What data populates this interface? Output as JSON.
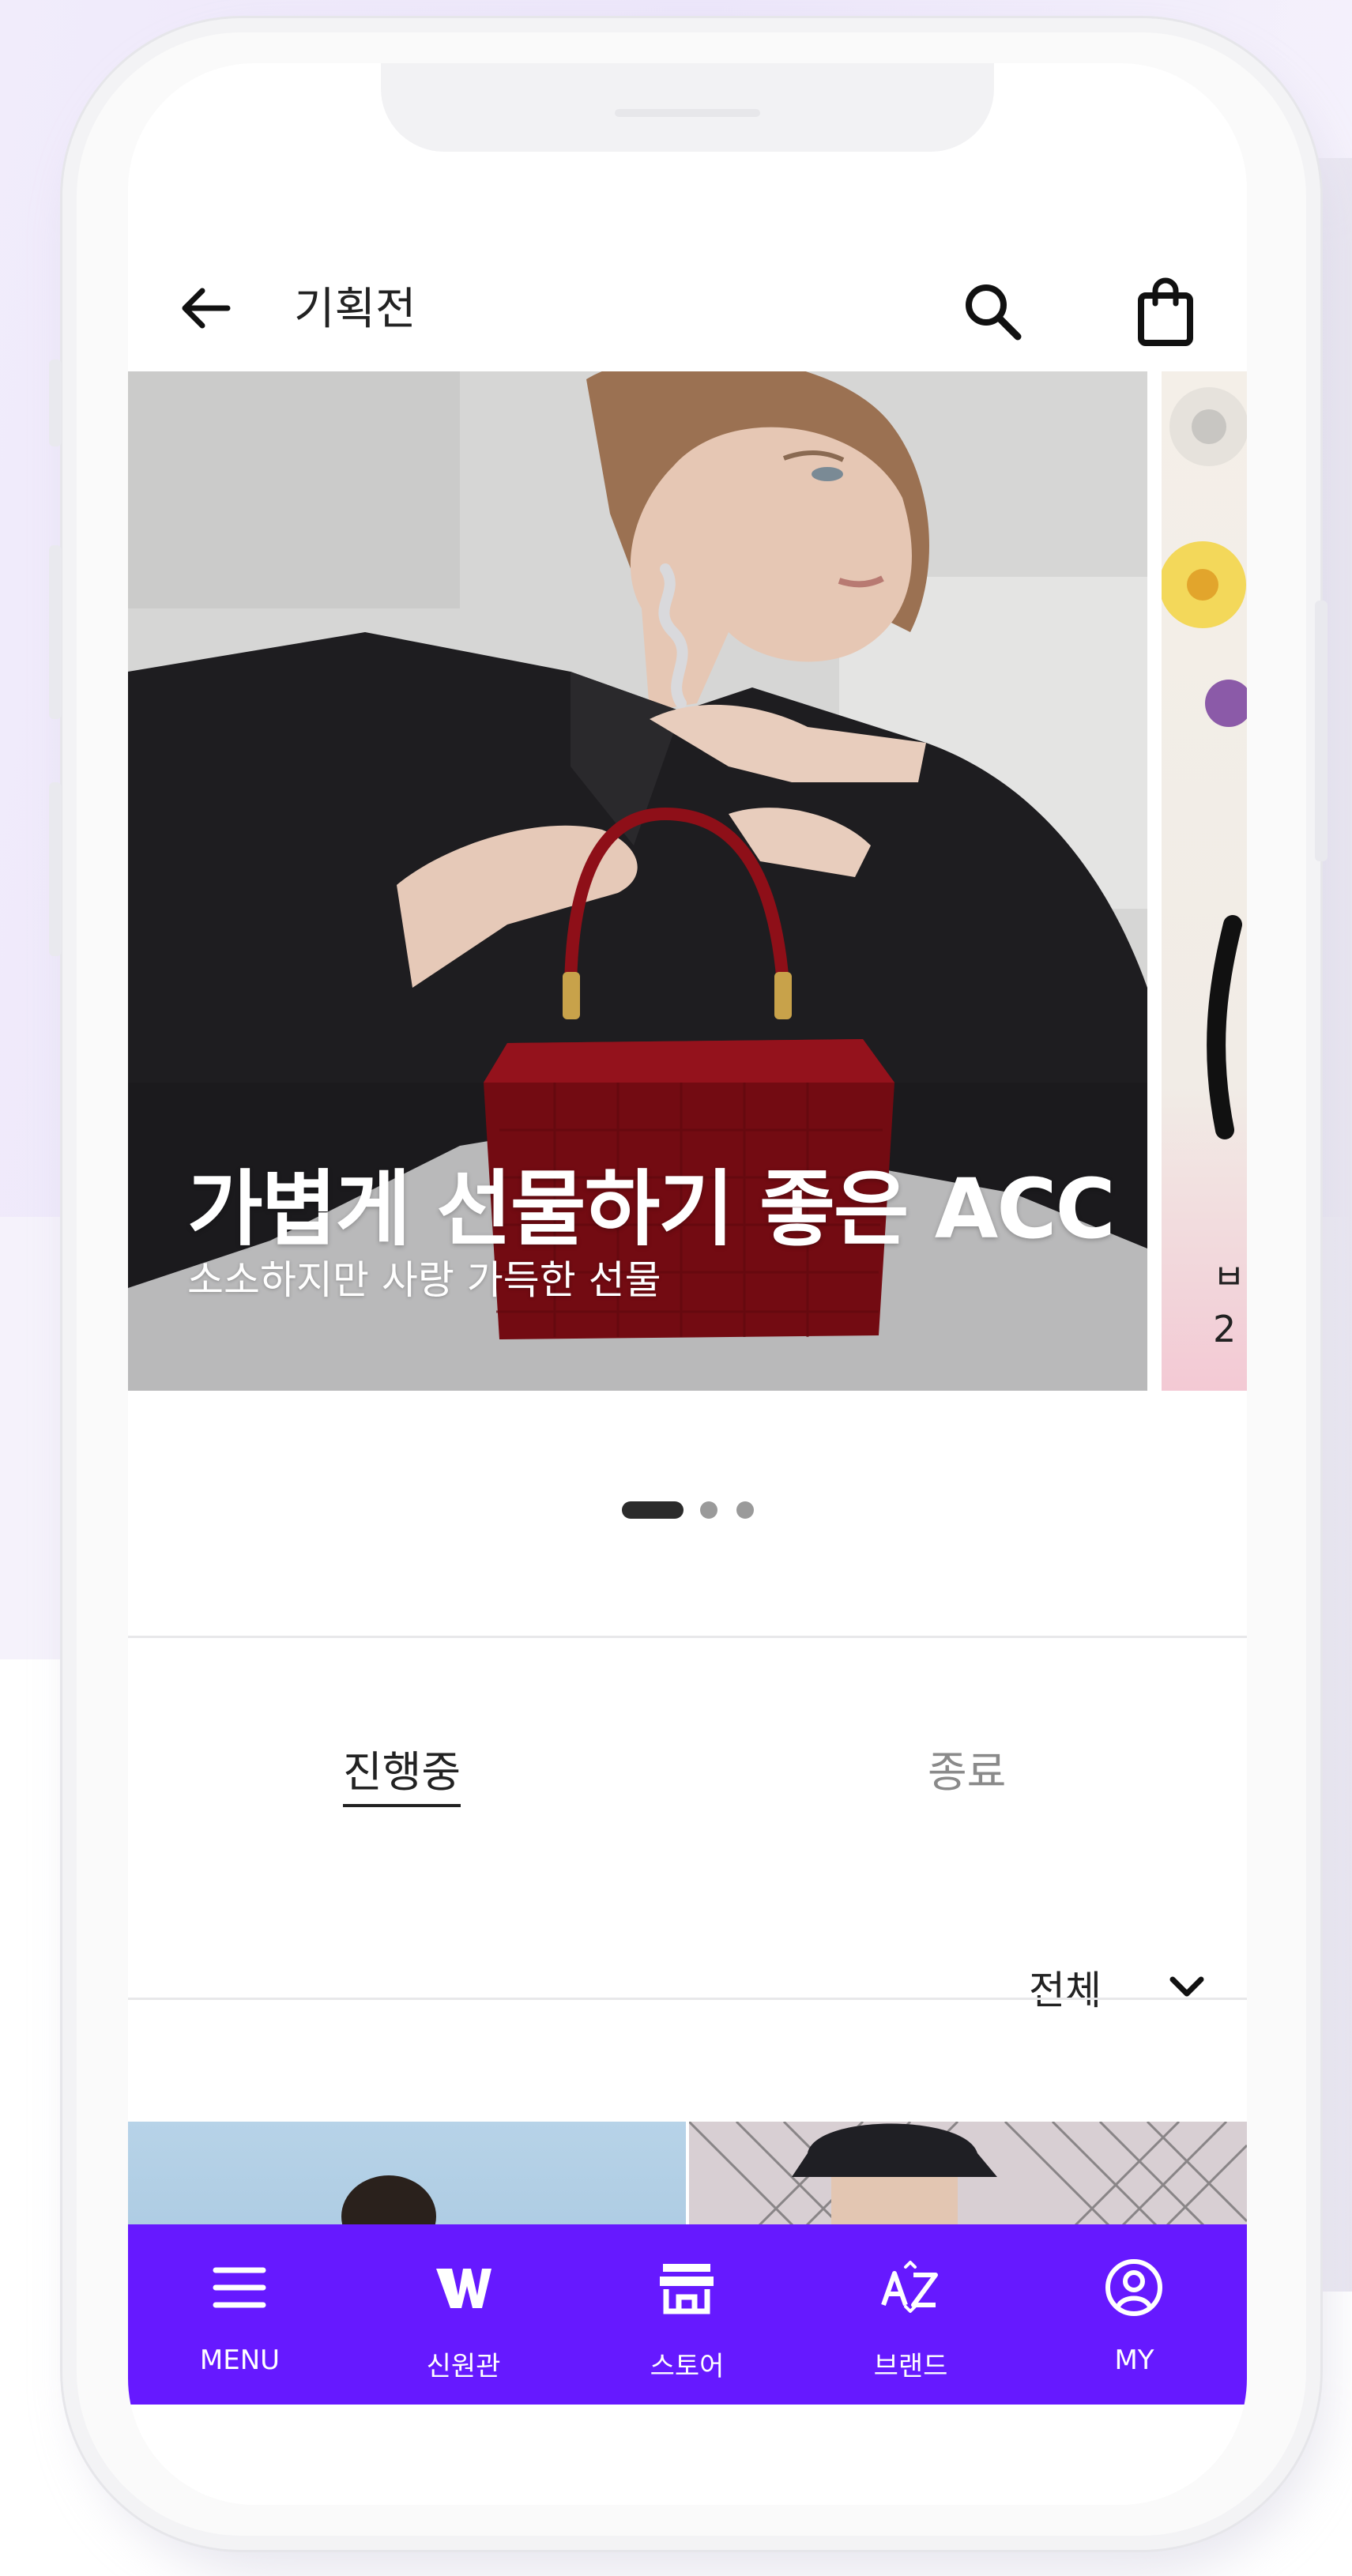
{
  "header": {
    "title": "기획전"
  },
  "carousel": {
    "slide_title": "가볍게 선물하기 좋은 ACC",
    "slide_subtitle": "소소하지만 사랑 가득한 선물",
    "next_peek_line1": "ㅂ",
    "next_peek_line2": "2",
    "active_index": 1,
    "total": 3
  },
  "tabs": [
    {
      "label": "진행중",
      "active": true
    },
    {
      "label": "종료",
      "active": false
    }
  ],
  "filter": {
    "selected": "전체"
  },
  "bottom_nav": [
    {
      "label": "MENU",
      "icon": "menu-icon"
    },
    {
      "label": "신원관",
      "icon": "shinwon-logo-icon"
    },
    {
      "label": "스토어",
      "icon": "store-icon"
    },
    {
      "label": "브랜드",
      "icon": "brand-az-icon"
    },
    {
      "label": "MY",
      "icon": "user-circle-icon"
    }
  ],
  "colors": {
    "nav_bg": "#6619ff",
    "text_primary": "#222222",
    "text_muted": "#8a8a8a"
  }
}
